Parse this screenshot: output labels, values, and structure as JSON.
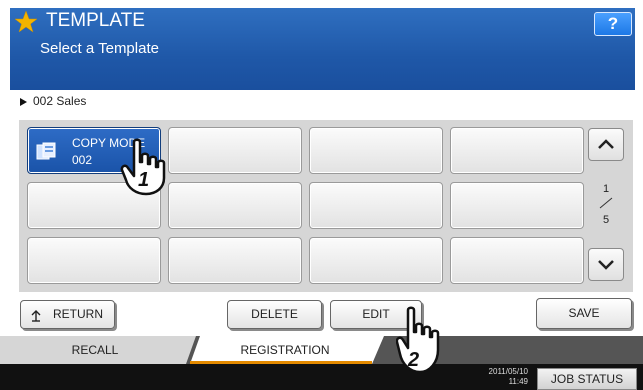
{
  "header": {
    "title": "TEMPLATE",
    "subtitle": "Select a Template",
    "help_label": "?"
  },
  "breadcrumb": {
    "text": "002 Sales"
  },
  "templates": [
    {
      "line1": "COPY MODE",
      "line2": "002",
      "active": true
    },
    {
      "line1": "",
      "line2": ""
    },
    {
      "line1": "",
      "line2": ""
    },
    {
      "line1": "",
      "line2": ""
    },
    {
      "line1": "",
      "line2": ""
    },
    {
      "line1": "",
      "line2": ""
    },
    {
      "line1": "",
      "line2": ""
    },
    {
      "line1": "",
      "line2": ""
    },
    {
      "line1": "",
      "line2": ""
    },
    {
      "line1": "",
      "line2": ""
    },
    {
      "line1": "",
      "line2": ""
    },
    {
      "line1": "",
      "line2": ""
    }
  ],
  "pager": {
    "current": "1",
    "total": "5"
  },
  "buttons": {
    "return": "RETURN",
    "delete": "DELETE",
    "edit": "EDIT",
    "save": "SAVE"
  },
  "tabs": {
    "recall": "RECALL",
    "registration": "REGISTRATION"
  },
  "status": {
    "date": "2011/05/10",
    "time": "11:49",
    "job_status": "JOB STATUS"
  },
  "callouts": [
    "1",
    "2"
  ],
  "colors": {
    "header_blue": "#1f58a8",
    "selected_blue": "#1a53a8",
    "tab_accent": "#e38a00"
  }
}
